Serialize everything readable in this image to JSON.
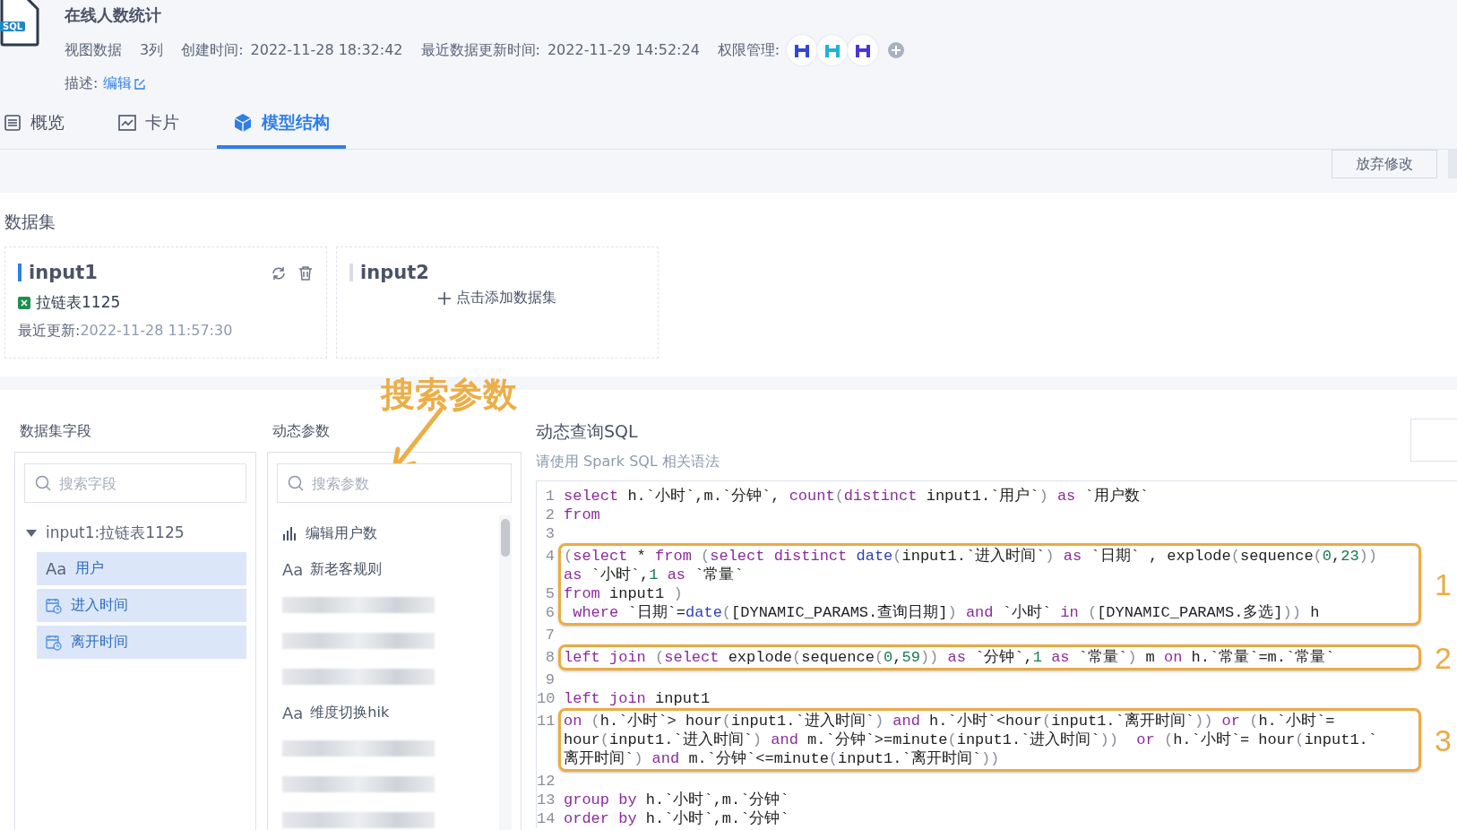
{
  "header": {
    "file_badge": "SQL",
    "title": "在线人数统计",
    "view_type": "视图数据",
    "columns_count": "3列",
    "created": {
      "label": "创建时间:",
      "value": "2022-11-28 18:32:42"
    },
    "updated": {
      "label": "最近数据更新时间:",
      "value": "2022-11-29 14:52:24"
    },
    "permissions": {
      "label": "权限管理:",
      "avatars": [
        {
          "color": "#3346d8"
        },
        {
          "color": "#1fb3d6"
        },
        {
          "color": "#4a36d6"
        }
      ]
    },
    "description": {
      "label": "描述:",
      "link": "编辑"
    }
  },
  "tabs": [
    {
      "label": "概览",
      "kind": "list",
      "selected": false
    },
    {
      "label": "卡片",
      "kind": "chart",
      "selected": false
    },
    {
      "label": "模型结构",
      "kind": "cube",
      "selected": true
    }
  ],
  "toolbar": {
    "buttons": [
      "放弃修改"
    ]
  },
  "datasets": {
    "title": "数据集",
    "cards": [
      {
        "kind": "dataset",
        "name": "input1",
        "active": true,
        "source": "拉链表1125",
        "updated_label": "最近更新:",
        "updated_value": "2022-11-28 11:57:30"
      },
      {
        "kind": "empty",
        "name": "input2",
        "active": false,
        "add_label": "点击添加数据集"
      }
    ]
  },
  "fields": {
    "title": "数据集字段",
    "search_placeholder": "搜索字段",
    "tree": [
      {
        "label": "input1:拉链表1125",
        "expanded": true,
        "children": [
          {
            "kind": "text",
            "type_label": "Aa",
            "label": "用户",
            "selected": true
          },
          {
            "kind": "date",
            "label": "进入时间",
            "selected": true
          },
          {
            "kind": "date",
            "label": "离开时间",
            "selected": true
          }
        ]
      }
    ]
  },
  "params": {
    "title": "动态参数",
    "search_placeholder": "搜索参数",
    "items": [
      {
        "kind": "measure",
        "label": "编辑用户数"
      },
      {
        "kind": "text",
        "type_label": "Aa",
        "label": "新老客规则"
      },
      {
        "kind": "redacted"
      },
      {
        "kind": "redacted"
      },
      {
        "kind": "redacted"
      },
      {
        "kind": "text",
        "type_label": "Aa",
        "label": "维度切换hik"
      },
      {
        "kind": "redacted"
      },
      {
        "kind": "redacted"
      },
      {
        "kind": "redacted"
      }
    ]
  },
  "callout": {
    "text": "搜索参数"
  },
  "sql": {
    "title": "动态查询SQL",
    "hint": "请使用 Spark SQL 相关语法",
    "blocks": [
      {
        "lines": [
          {
            "number": "1",
            "parts": [
              {
                "tokens": [
                  {
                    "kind": "kw",
                    "text": "select"
                  },
                  {
                    "kind": "plain",
                    "text": " h.`小时`,m.`分钟`, "
                  },
                  {
                    "kind": "kw",
                    "text": "count"
                  },
                  {
                    "kind": "punct",
                    "text": "("
                  },
                  {
                    "kind": "kw",
                    "text": "distinct"
                  },
                  {
                    "kind": "plain",
                    "text": " input1.`用户`"
                  },
                  {
                    "kind": "punct",
                    "text": ") "
                  },
                  {
                    "kind": "kw",
                    "text": "as"
                  },
                  {
                    "kind": "plain",
                    "text": " `用户数`"
                  }
                ]
              }
            ]
          },
          {
            "number": "2",
            "parts": [
              {
                "tokens": [
                  {
                    "kind": "kw",
                    "text": "from"
                  }
                ]
              }
            ]
          },
          {
            "number": "3"
          }
        ]
      },
      {
        "annotation": "1",
        "lines": [
          {
            "number": "4",
            "parts": [
              {
                "tokens": [
                  {
                    "kind": "punct",
                    "text": "("
                  },
                  {
                    "kind": "kw",
                    "text": "select"
                  },
                  {
                    "kind": "plain",
                    "text": " * "
                  },
                  {
                    "kind": "kw",
                    "text": "from "
                  },
                  {
                    "kind": "punct",
                    "text": "("
                  },
                  {
                    "kind": "kw",
                    "text": "select distinct "
                  },
                  {
                    "kind": "fn",
                    "text": "date"
                  },
                  {
                    "kind": "punct",
                    "text": "("
                  },
                  {
                    "kind": "plain",
                    "text": "input1.`进入时间`"
                  },
                  {
                    "kind": "punct",
                    "text": ") "
                  },
                  {
                    "kind": "kw",
                    "text": "as"
                  },
                  {
                    "kind": "plain",
                    "text": " `日期` , explode"
                  },
                  {
                    "kind": "punct",
                    "text": "("
                  },
                  {
                    "kind": "plain",
                    "text": "sequence"
                  },
                  {
                    "kind": "punct",
                    "text": "("
                  },
                  {
                    "kind": "num",
                    "text": "0"
                  },
                  {
                    "kind": "plain",
                    "text": ","
                  },
                  {
                    "kind": "num",
                    "text": "23"
                  },
                  {
                    "kind": "punct",
                    "text": "))"
                  }
                ]
              },
              {
                "tokens": [
                  {
                    "kind": "kw",
                    "text": "as"
                  },
                  {
                    "kind": "plain",
                    "text": " `小时`,"
                  },
                  {
                    "kind": "num",
                    "text": "1 "
                  },
                  {
                    "kind": "kw",
                    "text": "as"
                  },
                  {
                    "kind": "plain",
                    "text": " `常量`"
                  }
                ]
              }
            ]
          },
          {
            "number": "5",
            "parts": [
              {
                "tokens": [
                  {
                    "kind": "kw",
                    "text": "from"
                  },
                  {
                    "kind": "plain",
                    "text": " input1 "
                  },
                  {
                    "kind": "punct",
                    "text": ")"
                  }
                ]
              }
            ]
          },
          {
            "number": "6",
            "parts": [
              {
                "tokens": [
                  {
                    "kind": "kw",
                    "text": " where"
                  },
                  {
                    "kind": "plain",
                    "text": " `日期`="
                  },
                  {
                    "kind": "fn",
                    "text": "date"
                  },
                  {
                    "kind": "punct",
                    "text": "("
                  },
                  {
                    "kind": "plain",
                    "text": "[DYNAMIC_PARAMS.查询日期]"
                  },
                  {
                    "kind": "punct",
                    "text": ") "
                  },
                  {
                    "kind": "kw",
                    "text": "and"
                  },
                  {
                    "kind": "plain",
                    "text": " `小时` "
                  },
                  {
                    "kind": "kw",
                    "text": "in "
                  },
                  {
                    "kind": "punct",
                    "text": "("
                  },
                  {
                    "kind": "plain",
                    "text": "[DYNAMIC_PARAMS.多选]"
                  },
                  {
                    "kind": "punct",
                    "text": "))"
                  },
                  {
                    "kind": "plain",
                    "text": " h"
                  }
                ]
              }
            ]
          }
        ]
      },
      {
        "lines": [
          {
            "number": "7"
          }
        ]
      },
      {
        "annotation": "2",
        "lines": [
          {
            "number": "8",
            "parts": [
              {
                "tokens": [
                  {
                    "kind": "kw",
                    "text": "left join "
                  },
                  {
                    "kind": "punct",
                    "text": "("
                  },
                  {
                    "kind": "kw",
                    "text": "select"
                  },
                  {
                    "kind": "plain",
                    "text": " explode"
                  },
                  {
                    "kind": "punct",
                    "text": "("
                  },
                  {
                    "kind": "plain",
                    "text": "sequence"
                  },
                  {
                    "kind": "punct",
                    "text": "("
                  },
                  {
                    "kind": "num",
                    "text": "0"
                  },
                  {
                    "kind": "plain",
                    "text": ","
                  },
                  {
                    "kind": "num",
                    "text": "59"
                  },
                  {
                    "kind": "punct",
                    "text": ")) "
                  },
                  {
                    "kind": "kw",
                    "text": "as"
                  },
                  {
                    "kind": "plain",
                    "text": " `分钟`,"
                  },
                  {
                    "kind": "num",
                    "text": "1 "
                  },
                  {
                    "kind": "kw",
                    "text": "as"
                  },
                  {
                    "kind": "plain",
                    "text": " `常量`"
                  },
                  {
                    "kind": "punct",
                    "text": ")"
                  },
                  {
                    "kind": "plain",
                    "text": " m "
                  },
                  {
                    "kind": "kw",
                    "text": "on"
                  },
                  {
                    "kind": "plain",
                    "text": " h.`常量`=m.`常量`"
                  }
                ]
              }
            ]
          }
        ]
      },
      {
        "lines": [
          {
            "number": "9"
          },
          {
            "number": "10",
            "parts": [
              {
                "tokens": [
                  {
                    "kind": "kw",
                    "text": "left join"
                  },
                  {
                    "kind": "plain",
                    "text": " input1"
                  }
                ]
              }
            ]
          }
        ]
      },
      {
        "annotation": "3",
        "lines": [
          {
            "number": "11",
            "parts": [
              {
                "tokens": [
                  {
                    "kind": "kw",
                    "text": "on "
                  },
                  {
                    "kind": "punct",
                    "text": "("
                  },
                  {
                    "kind": "plain",
                    "text": "h.`小时`> hour"
                  },
                  {
                    "kind": "punct",
                    "text": "("
                  },
                  {
                    "kind": "plain",
                    "text": "input1.`进入时间`"
                  },
                  {
                    "kind": "punct",
                    "text": ") "
                  },
                  {
                    "kind": "kw",
                    "text": "and"
                  },
                  {
                    "kind": "plain",
                    "text": " h.`小时`<hour"
                  },
                  {
                    "kind": "punct",
                    "text": "("
                  },
                  {
                    "kind": "plain",
                    "text": "input1.`离开时间`"
                  },
                  {
                    "kind": "punct",
                    "text": ")) "
                  },
                  {
                    "kind": "kw",
                    "text": "or "
                  },
                  {
                    "kind": "punct",
                    "text": "("
                  },
                  {
                    "kind": "plain",
                    "text": "h.`小时`="
                  }
                ]
              },
              {
                "tokens": [
                  {
                    "kind": "plain",
                    "text": "hour"
                  },
                  {
                    "kind": "punct",
                    "text": "("
                  },
                  {
                    "kind": "plain",
                    "text": "input1.`进入时间`"
                  },
                  {
                    "kind": "punct",
                    "text": ") "
                  },
                  {
                    "kind": "kw",
                    "text": "and"
                  },
                  {
                    "kind": "plain",
                    "text": " m.`分钟`>=minute"
                  },
                  {
                    "kind": "punct",
                    "text": "("
                  },
                  {
                    "kind": "plain",
                    "text": "input1.`进入时间`"
                  },
                  {
                    "kind": "punct",
                    "text": "))  "
                  },
                  {
                    "kind": "kw",
                    "text": "or "
                  },
                  {
                    "kind": "punct",
                    "text": "("
                  },
                  {
                    "kind": "plain",
                    "text": "h.`小时`= hour"
                  },
                  {
                    "kind": "punct",
                    "text": "("
                  },
                  {
                    "kind": "plain",
                    "text": "input1.`"
                  }
                ]
              },
              {
                "tokens": [
                  {
                    "kind": "plain",
                    "text": "离开时间`"
                  },
                  {
                    "kind": "punct",
                    "text": ") "
                  },
                  {
                    "kind": "kw",
                    "text": "and"
                  },
                  {
                    "kind": "plain",
                    "text": " m.`分钟`<=minute"
                  },
                  {
                    "kind": "punct",
                    "text": "("
                  },
                  {
                    "kind": "plain",
                    "text": "input1.`离开时间`"
                  },
                  {
                    "kind": "punct",
                    "text": "))"
                  }
                ]
              }
            ]
          }
        ]
      },
      {
        "lines": [
          {
            "number": "12"
          },
          {
            "number": "13",
            "parts": [
              {
                "tokens": [
                  {
                    "kind": "kw",
                    "text": "group by"
                  },
                  {
                    "kind": "plain",
                    "text": " h.`小时`,m.`分钟`"
                  }
                ]
              }
            ]
          },
          {
            "number": "14",
            "parts": [
              {
                "tokens": [
                  {
                    "kind": "kw",
                    "text": "order by"
                  },
                  {
                    "kind": "plain",
                    "text": " h.`小时`,m.`分钟`"
                  }
                ]
              }
            ]
          }
        ]
      }
    ]
  }
}
